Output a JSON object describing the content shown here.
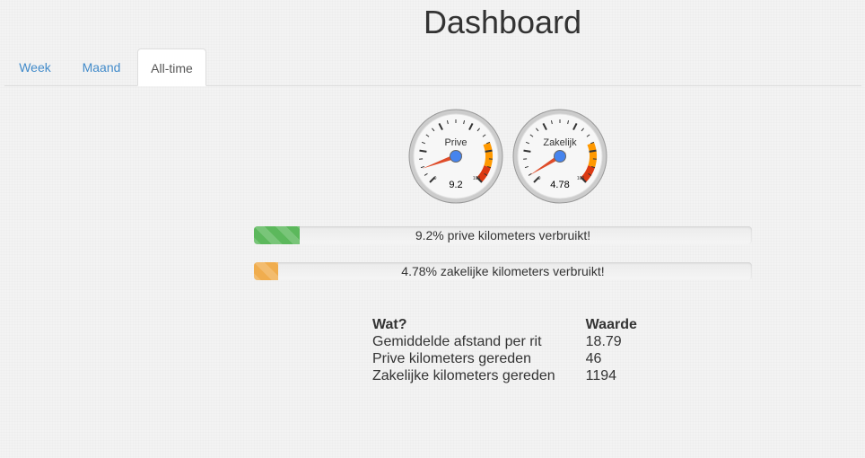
{
  "header": {
    "title": "Dashboard"
  },
  "tabs": [
    {
      "label": "Week",
      "active": false
    },
    {
      "label": "Maand",
      "active": false
    },
    {
      "label": "All-time",
      "active": true
    }
  ],
  "gauges": [
    {
      "label": "Prive",
      "value": 9.2,
      "value_text": "9.2",
      "min": 0,
      "max": 100,
      "min_label": "0",
      "max_label": "100"
    },
    {
      "label": "Zakelijk",
      "value": 4.78,
      "value_text": "4.78",
      "min": 0,
      "max": 100,
      "min_label": "0",
      "max_label": "100"
    }
  ],
  "progress": [
    {
      "percent": 9.2,
      "label": "9.2% prive kilometers verbruikt!",
      "color": "#5cb85c"
    },
    {
      "percent": 4.78,
      "label": "4.78% zakelijke kilometers verbruikt!",
      "color": "#f0ad4e"
    }
  ],
  "stats": {
    "headers": [
      "Wat?",
      "Waarde"
    ],
    "rows": [
      [
        "Gemiddelde afstand per rit",
        "18.79"
      ],
      [
        "Prive kilometers gereden",
        "46"
      ],
      [
        "Zakelijke kilometers gereden",
        "1194"
      ]
    ]
  },
  "colors": {
    "accent": "#428bca",
    "gauge_needle": "#dc3912",
    "gauge_center": "#4684ee",
    "gauge_yellow": "#ff9900",
    "gauge_red": "#dc3912"
  }
}
